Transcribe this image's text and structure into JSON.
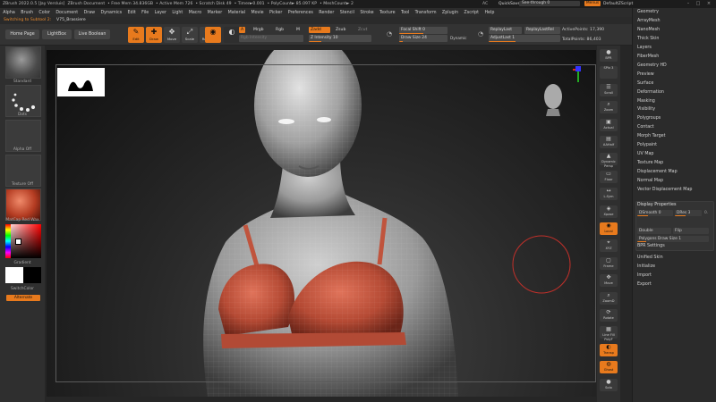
{
  "titlebar": {
    "app": "ZBrush 2022.0.5 [Jay Versluis]",
    "doc": "ZBrush Document",
    "free_mem": "• Free Mem 34.836GB",
    "active_mem": "• Active Mem 726",
    "scratch": "• Scratch Disk 49",
    "timer": "• Timer►0.001",
    "polycount": "• PolyCount► 85.097 KP",
    "meshcount": "• MeshCount► 2",
    "ac": "AC",
    "quicksave": "QuickSave",
    "see_through": "See-through  0",
    "menus": "Menus",
    "default_zscript": "DefaultZScript"
  },
  "menubar": [
    "Alpha",
    "Brush",
    "Color",
    "Document",
    "Draw",
    "Dynamics",
    "Edit",
    "File",
    "Layer",
    "Light",
    "Macro",
    "Marker",
    "Material",
    "Movie",
    "Picker",
    "Preferences",
    "Render",
    "Stencil",
    "Stroke",
    "Texture",
    "Tool",
    "Transform",
    "Zplugin",
    "Zscript",
    "Help"
  ],
  "status": {
    "switching": "Switching to Subtool 2:",
    "subtool": "V75_Brassiere"
  },
  "toolbar": {
    "home_page": "Home Page",
    "lightbox": "LightBox",
    "live_boolean": "Live Boolean",
    "tools": [
      {
        "label": "Edit",
        "glyph": "✎",
        "on": true
      },
      {
        "label": "Draw",
        "glyph": "✚",
        "on": true
      },
      {
        "label": "Move",
        "glyph": "✥",
        "on": false
      },
      {
        "label": "Scale",
        "glyph": "⤢",
        "on": false
      },
      {
        "label": "Rotate",
        "glyph": "⟳",
        "on": false
      }
    ],
    "a_chip": "A",
    "mrgb": "Mrgb",
    "rgb": "Rgb",
    "m": "M",
    "zadd": "Zadd",
    "zsub": "Zsub",
    "zcut": "Zcut",
    "rgb_intensity": "Rgb Intensity",
    "z_intensity": "Z Intensity 10",
    "focal_shift": "Focal Shift 0",
    "draw_size": "Draw Size 24",
    "dynamic": "Dynamic",
    "replay_last": "ReplayLast",
    "replay_last_rel": "ReplayLastRel",
    "adjust_last": "AdjustLast 1",
    "active_points": "ActivePoints: 17,390",
    "total_points": "TotalPoints: 86,403"
  },
  "leftshelf": {
    "standard": "Standard",
    "dots": "Dots",
    "alpha_off": "Alpha Off",
    "texture_off": "Texture Off",
    "matcap": "MatCap Red Wax",
    "gradient": "Gradient",
    "switch_color": "SwitchColor",
    "alternate": "Alternate"
  },
  "rightbar": [
    {
      "label": "BPR",
      "glyph": "●",
      "on": false
    },
    {
      "label": "SPix 3",
      "glyph": "",
      "on": false
    },
    {
      "label": "Scroll",
      "glyph": "☰",
      "on": false
    },
    {
      "label": "Zoom",
      "glyph": "⌕",
      "on": false
    },
    {
      "label": "Actual",
      "glyph": "▣",
      "on": false
    },
    {
      "label": "AAHalf",
      "glyph": "▤",
      "on": false
    },
    {
      "label": "Dynamic Persp",
      "glyph": "▲",
      "on": false
    },
    {
      "label": "Floor",
      "glyph": "▭",
      "on": false
    },
    {
      "label": "L.Sym",
      "glyph": "↔",
      "on": false
    },
    {
      "label": "Xpose",
      "glyph": "◈",
      "on": false
    },
    {
      "label": "Local",
      "glyph": "◉",
      "on": true
    },
    {
      "label": "XYZ",
      "glyph": "⌖",
      "on": false
    },
    {
      "label": "Frame",
      "glyph": "▢",
      "on": false
    },
    {
      "label": "Move",
      "glyph": "✥",
      "on": false
    },
    {
      "label": "ZoomD",
      "glyph": "⌕",
      "on": false
    },
    {
      "label": "Rotate",
      "glyph": "⟳",
      "on": false
    },
    {
      "label": "Line Fill PolyF",
      "glyph": "▦",
      "on": false
    },
    {
      "label": "Transp",
      "glyph": "◐",
      "on": true
    },
    {
      "label": "Ghost",
      "glyph": "◍",
      "on": true
    },
    {
      "label": "Solo",
      "glyph": "●",
      "on": false
    }
  ],
  "toolpanel": {
    "items_top": [
      "Geometry",
      "ArrayMesh",
      "NanoMesh",
      "Thick Skin",
      "Layers",
      "FiberMesh",
      "Geometry HD",
      "Preview",
      "Surface",
      "Deformation",
      "Masking",
      "Visibility",
      "Polygroups",
      "Contact",
      "Morph Target",
      "Polypaint",
      "UV Map",
      "Texture Map",
      "Displacement Map",
      "Normal Map",
      "Vector Displacement Map"
    ],
    "display_properties": "Display Properties",
    "dsmooth": "DSmooth 0",
    "dres": "DRes 3",
    "dres_extra": "0.",
    "double": "Double",
    "flip": "Flip",
    "polygons_draw_size": "Polygons Draw Size 1",
    "bpr_settings": "BPR Settings",
    "items_bottom": [
      "Unified Skin",
      "Initialize",
      "Import",
      "Export"
    ]
  },
  "colors": {
    "accent": "#e87a1d",
    "bra": "#c0543d",
    "brush_ring": "#c0302a"
  }
}
